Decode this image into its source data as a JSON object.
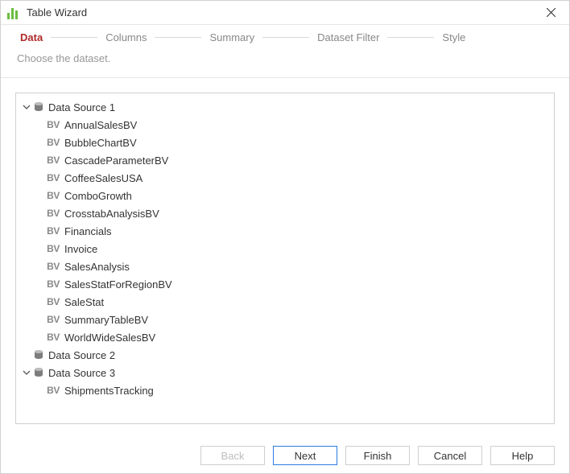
{
  "window": {
    "title": "Table Wizard"
  },
  "steps": [
    {
      "label": "Data",
      "active": true
    },
    {
      "label": "Columns",
      "active": false
    },
    {
      "label": "Summary",
      "active": false
    },
    {
      "label": "Dataset Filter",
      "active": false
    },
    {
      "label": "Style",
      "active": false
    }
  ],
  "subtitle": "Choose the dataset.",
  "tree": {
    "sources": [
      {
        "label": "Data Source 1",
        "expandable": true,
        "expanded": true,
        "items": [
          {
            "label": "AnnualSalesBV"
          },
          {
            "label": "BubbleChartBV"
          },
          {
            "label": "CascadeParameterBV"
          },
          {
            "label": "CoffeeSalesUSA"
          },
          {
            "label": "ComboGrowth"
          },
          {
            "label": "CrosstabAnalysisBV"
          },
          {
            "label": "Financials"
          },
          {
            "label": "Invoice"
          },
          {
            "label": "SalesAnalysis"
          },
          {
            "label": "SalesStatForRegionBV"
          },
          {
            "label": "SaleStat"
          },
          {
            "label": "SummaryTableBV"
          },
          {
            "label": "WorldWideSalesBV"
          }
        ]
      },
      {
        "label": "Data Source 2",
        "expandable": false,
        "expanded": false,
        "items": []
      },
      {
        "label": "Data Source 3",
        "expandable": true,
        "expanded": true,
        "items": [
          {
            "label": "ShipmentsTracking"
          }
        ]
      }
    ]
  },
  "icons": {
    "bv_text": "BV"
  },
  "buttons": {
    "back": "Back",
    "next": "Next",
    "finish": "Finish",
    "cancel": "Cancel",
    "help": "Help"
  }
}
